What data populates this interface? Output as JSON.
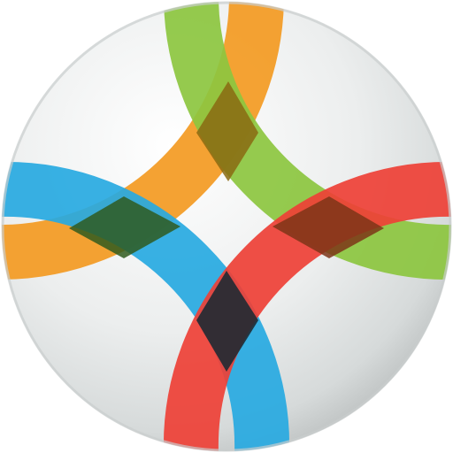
{
  "icon": {
    "name": "interlocking-arcs-badge",
    "colors": {
      "badge_light": "#f4f5f5",
      "badge_mid": "#dfe2e2",
      "badge_shadow": "#b9bdbd",
      "orange": "#f39a22",
      "green": "#8cc63f",
      "blue": "#27a9e1",
      "red": "#ee4036",
      "overlap_orange_green": "#8a6a12",
      "overlap_orange_blue": "#2f5a1e",
      "overlap_green_red": "#7d3518",
      "overlap_blue_red": "#1f2a33"
    }
  }
}
